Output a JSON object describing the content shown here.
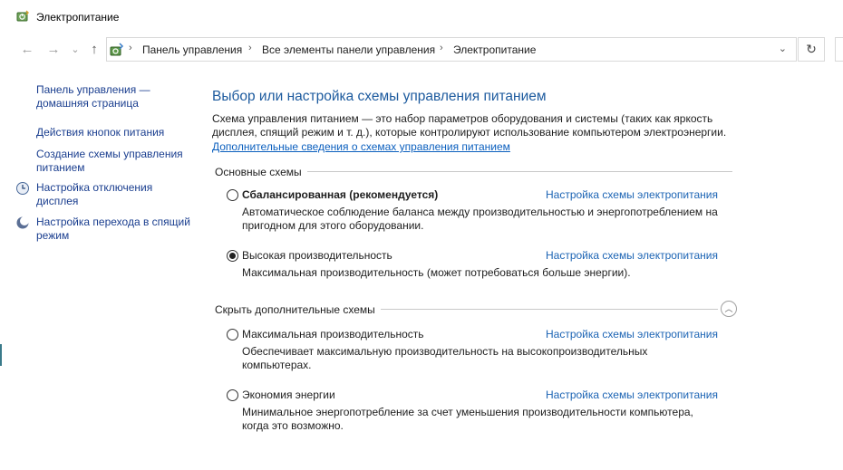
{
  "window": {
    "title": "Электропитание",
    "app_icon": "power-options-icon"
  },
  "nav": {
    "back_icon": "←",
    "forward_icon": "→",
    "recent_icon": "⌄",
    "up_icon": "↑",
    "refresh_icon": "↻",
    "dropdown_icon": "⌄"
  },
  "address": {
    "breadcrumbs": [
      "Панель управления",
      "Все элементы панели управления",
      "Электропитание"
    ],
    "separator": "›"
  },
  "sidebar": {
    "items": [
      {
        "label": "Панель управления — домашняя страница"
      },
      {
        "label": "Действия кнопок питания"
      },
      {
        "label": "Создание схемы управления питанием"
      },
      {
        "label": "Настройка отключения дисплея",
        "icon": "display-off-icon"
      },
      {
        "label": "Настройка перехода в спящий режим",
        "icon": "sleep-moon-icon"
      }
    ]
  },
  "main": {
    "heading": "Выбор или настройка схемы управления питанием",
    "description": "Схема управления питанием — это набор параметров оборудования и системы (таких как яркость дисплея, спящий режим и т. д.), которые контролируют использование компьютером электроэнергии.",
    "more_link": "Дополнительные сведения о схемах управления питанием",
    "basic_group_label": "Основные схемы",
    "hidden_group_label": "Скрыть дополнительные схемы",
    "collapse_icon": "︿",
    "plan_link_label": "Настройка схемы электропитания",
    "plans": [
      {
        "name": "Сбалансированная (рекомендуется)",
        "description": "Автоматическое соблюдение баланса между производительностью и энергопотреблением на пригодном для этого оборудовании.",
        "selected": false
      },
      {
        "name": "Высокая производительность",
        "description": "Максимальная производительность (может потребоваться больше энергии).",
        "selected": true
      },
      {
        "name": "Максимальная производительность",
        "description": "Обеспечивает максимальную производительность на высокопроизводительных компьютерах.",
        "selected": false
      },
      {
        "name": "Экономия энергии",
        "description": "Минимальное энергопотребление за счет уменьшения производительности компьютера, когда это возможно.",
        "selected": false
      }
    ]
  },
  "colors": {
    "link": "#1c64b4",
    "heading": "#1c5a9e",
    "sidebar_link": "#1a3e8f"
  }
}
